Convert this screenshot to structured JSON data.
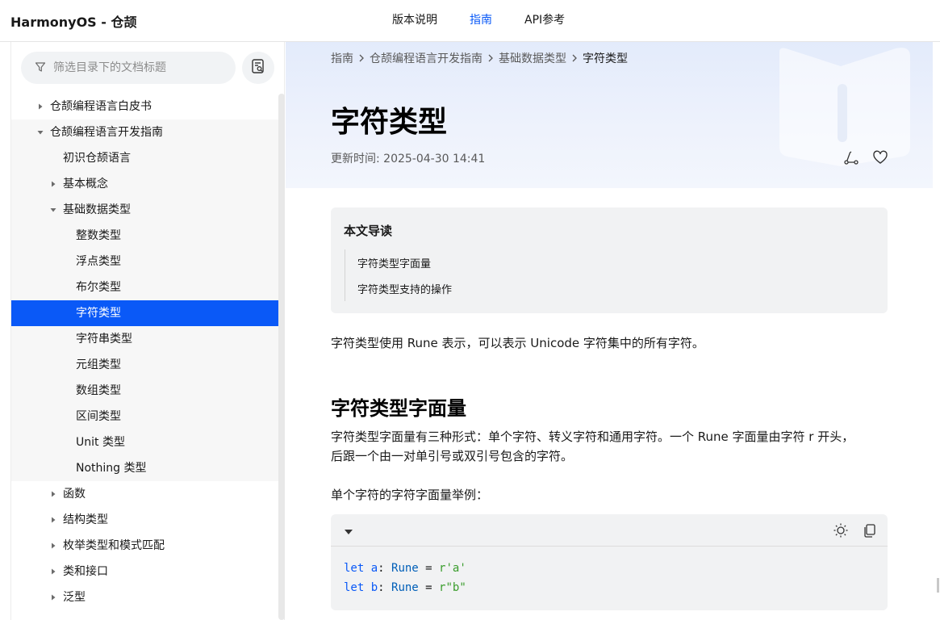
{
  "header": {
    "brand": "HarmonyOS - 仓颉",
    "nav": [
      {
        "label": "版本说明",
        "active": false
      },
      {
        "label": "指南",
        "active": true
      },
      {
        "label": "API参考",
        "active": false
      }
    ]
  },
  "sidebar": {
    "search_placeholder": "筛选目录下的文档标题",
    "items": [
      {
        "label": "仓颉编程语言白皮书",
        "expanded": false
      },
      {
        "label": "仓颉编程语言开发指南",
        "expanded": true
      },
      {
        "label": "初识仓颉语言"
      },
      {
        "label": "基本概念",
        "expanded": false
      },
      {
        "label": "基础数据类型",
        "expanded": true
      },
      {
        "label": "整数类型"
      },
      {
        "label": "浮点类型"
      },
      {
        "label": "布尔类型"
      },
      {
        "label": "字符类型",
        "selected": true
      },
      {
        "label": "字符串类型"
      },
      {
        "label": "元组类型"
      },
      {
        "label": "数组类型"
      },
      {
        "label": "区间类型"
      },
      {
        "label": "Unit 类型"
      },
      {
        "label": "Nothing 类型"
      },
      {
        "label": "函数",
        "expanded": false
      },
      {
        "label": "结构类型",
        "expanded": false
      },
      {
        "label": "枚举类型和模式匹配",
        "expanded": false
      },
      {
        "label": "类和接口",
        "expanded": false
      },
      {
        "label": "泛型",
        "expanded": false
      }
    ]
  },
  "breadcrumb": [
    "指南",
    "仓颉编程语言开发指南",
    "基础数据类型",
    "字符类型"
  ],
  "page": {
    "title": "字符类型",
    "updated": "更新时间: 2025-04-30 14:41"
  },
  "toc": {
    "title": "本文导读",
    "links": [
      "字符类型字面量",
      "字符类型支持的操作"
    ]
  },
  "content": {
    "intro": "字符类型使用 Rune 表示，可以表示 Unicode 字符集中的所有字符。",
    "h2": "字符类型字面量",
    "p1_line1": "字符类型字面量有三种形式：单个字符、转义字符和通用字符。一个 Rune 字面量由字符 r 开头，",
    "p1_line2": "后跟一个由一对单引号或双引号包含的字符。",
    "p2": "单个字符的字符字面量举例："
  },
  "code": {
    "lines": [
      {
        "kw": "let",
        "name": " a",
        "colon": ": ",
        "type": "Rune",
        "eq": " = ",
        "val": "r'a'"
      },
      {
        "kw": "let",
        "name": " b",
        "colon": ": ",
        "type": "Rune",
        "eq": " = ",
        "val": "r\"b\""
      }
    ]
  },
  "colors": {
    "accent": "#0a59f7",
    "selected_bg": "#0a59f7"
  },
  "icons": [
    "funnel-icon",
    "doc-search-icon",
    "caret-right-icon",
    "caret-down-icon",
    "chevron-right-icon",
    "share-icon",
    "heart-icon",
    "sun-icon",
    "copy-icon",
    "book-icon"
  ]
}
